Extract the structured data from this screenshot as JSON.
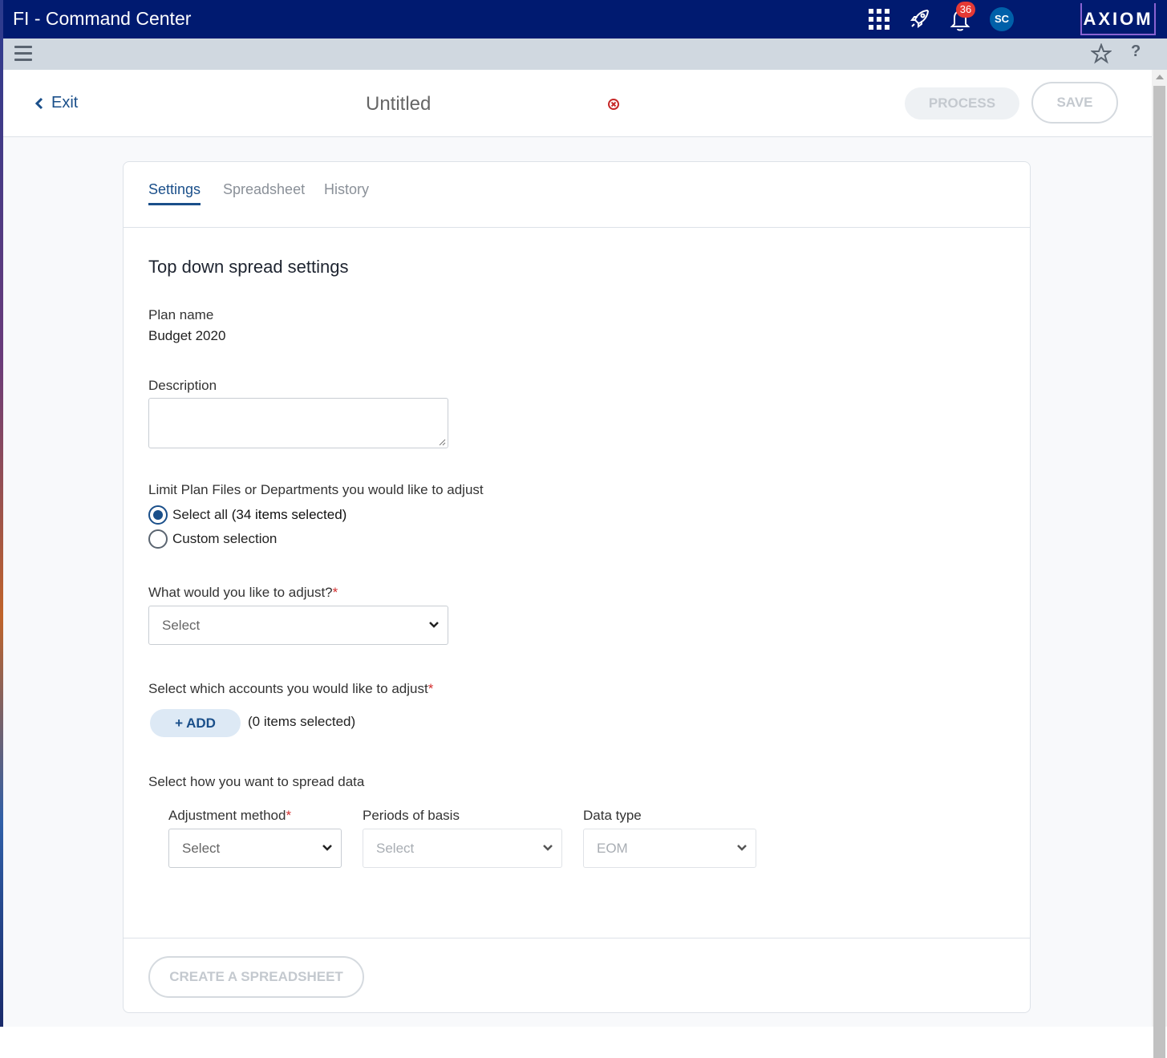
{
  "app": {
    "title": "FI - Command Center",
    "logo": "AXIOM",
    "notification_count": "36",
    "avatar_initials": "SC"
  },
  "icons": {
    "apps": "grid-icon",
    "launch": "rocket-icon",
    "notifications": "bell-icon",
    "menu": "hamburger-icon",
    "favorite": "star-icon",
    "help": "?"
  },
  "header": {
    "exit_label": "Exit",
    "doc_title": "Untitled",
    "process_label": "PROCESS",
    "save_label": "SAVE"
  },
  "tabs": [
    {
      "label": "Settings",
      "active": true
    },
    {
      "label": "Spreadsheet",
      "active": false
    },
    {
      "label": "History",
      "active": false
    }
  ],
  "form": {
    "section_title": "Top down spread settings",
    "plan_name_label": "Plan name",
    "plan_name_value": "Budget 2020",
    "description_label": "Description",
    "description_value": "",
    "limit_label": "Limit Plan Files or Departments you would like to adjust",
    "radio_select_all": "Select all",
    "radio_select_all_count": "(34 items selected)",
    "radio_custom": "Custom selection",
    "adjust_label": "What would you like to adjust?",
    "adjust_value": "Select",
    "accounts_label": "Select which accounts you would like to adjust",
    "add_label": "+ ADD",
    "accounts_count": "(0 items selected)",
    "spread_label": "Select how you want to spread data",
    "method_label": "Adjustment method",
    "method_value": "Select",
    "periods_label": "Periods of basis",
    "periods_value": "Select",
    "datatype_label": "Data type",
    "datatype_value": "EOM",
    "required_mark": "*",
    "create_label": "CREATE A SPREADSHEET"
  },
  "colors": {
    "topbar": "#001a70",
    "accent": "#1a4f8a",
    "badge": "#e53935",
    "required": "#d32f2f"
  }
}
